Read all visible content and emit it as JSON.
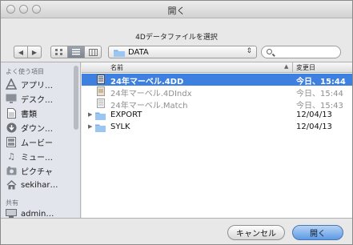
{
  "window": {
    "title": "開く"
  },
  "message": "4Dデータファイルを選択",
  "toolbar": {
    "path_label": "DATA"
  },
  "sidebar": {
    "header_places": "よく使う項目",
    "header_shared": "共有",
    "items": [
      {
        "label": "アプリ…",
        "icon": "applications-icon"
      },
      {
        "label": "デスク…",
        "icon": "desktop-icon"
      },
      {
        "label": "書類",
        "icon": "documents-icon"
      },
      {
        "label": "ダウン…",
        "icon": "downloads-icon"
      },
      {
        "label": "ムービー",
        "icon": "movies-icon"
      },
      {
        "label": "ミュー…",
        "icon": "music-icon"
      },
      {
        "label": "ピクチャ",
        "icon": "pictures-icon"
      },
      {
        "label": "sekihar…",
        "icon": "home-icon"
      }
    ],
    "shared": [
      {
        "label": "admin…",
        "icon": "computer-icon"
      }
    ]
  },
  "list": {
    "col_name": "名前",
    "col_date": "変更日",
    "rows": [
      {
        "name": "24年マーベル.4DD",
        "date": "今日、15:44",
        "type": "file",
        "state": "selected"
      },
      {
        "name": "24年マーベル.4DIndx",
        "date": "今日、15:44",
        "type": "file",
        "state": "dim"
      },
      {
        "name": "24年マーベル.Match",
        "date": "今日、15:43",
        "type": "file",
        "state": "dim"
      },
      {
        "name": "EXPORT",
        "date": "12/04/13",
        "type": "folder",
        "state": "normal"
      },
      {
        "name": "SYLK",
        "date": "12/04/13",
        "type": "folder",
        "state": "normal"
      }
    ]
  },
  "buttons": {
    "cancel": "キャンセル",
    "open": "開く"
  },
  "colors": {
    "selection": "#3d80df",
    "default_button": "#5d9ae6"
  }
}
